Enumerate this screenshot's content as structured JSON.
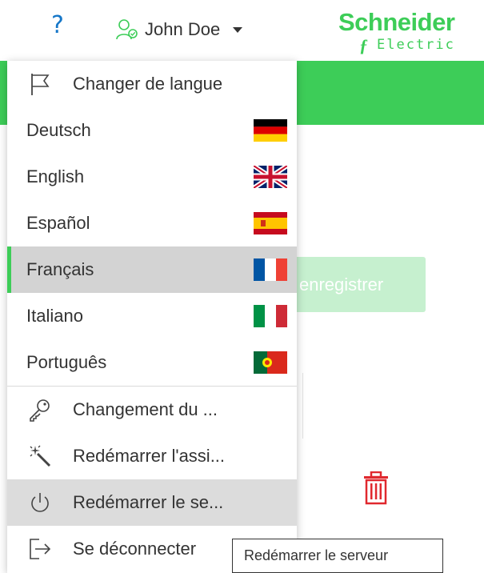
{
  "header": {
    "help_symbol": "?",
    "user_name": "John Doe",
    "logo_line1": "Schneider",
    "logo_line2": "Electric"
  },
  "background": {
    "save_button_label": "enregistrer"
  },
  "menu": {
    "change_language_label": "Changer de langue",
    "languages": [
      {
        "label": "Deutsch",
        "flag": "flag-de-icon"
      },
      {
        "label": "English",
        "flag": "flag-uk-icon"
      },
      {
        "label": "Español",
        "flag": "flag-es-icon"
      },
      {
        "label": "Français",
        "flag": "flag-fr-icon",
        "selected": true
      },
      {
        "label": "Italiano",
        "flag": "flag-it-icon"
      },
      {
        "label": "Português",
        "flag": "flag-pt-icon"
      }
    ],
    "actions": [
      {
        "label": "Changement du ...",
        "icon": "key-icon"
      },
      {
        "label": "Redémarrer l'assi...",
        "icon": "magic-wand-icon"
      },
      {
        "label": "Redémarrer le se...",
        "icon": "power-icon",
        "hover": true
      },
      {
        "label": "Se déconnecter",
        "icon": "logout-icon"
      }
    ]
  },
  "tooltip": {
    "text": "Redémarrer le serveur"
  },
  "colors": {
    "accent_green": "#3dcd58",
    "help_blue": "#1677c8",
    "trash_red": "#e0282e"
  }
}
